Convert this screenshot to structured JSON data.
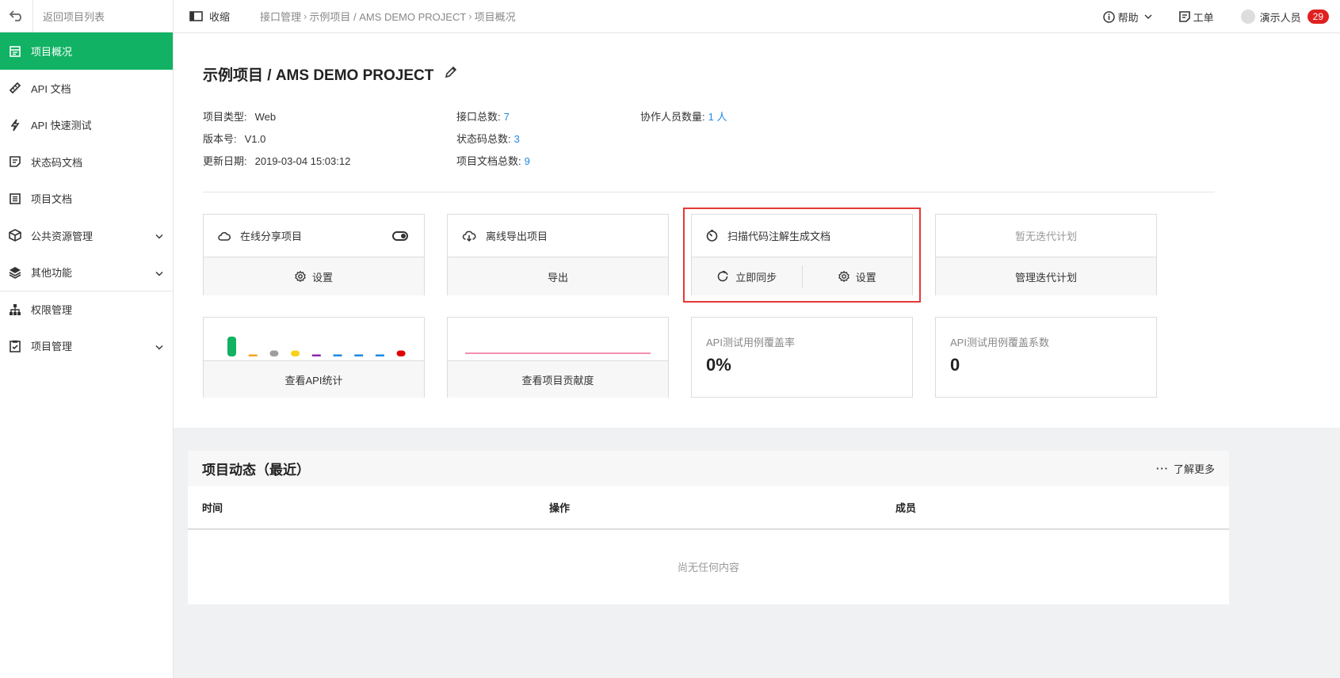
{
  "sidebar": {
    "back_label": "返回项目列表",
    "items": [
      {
        "label": "项目概况",
        "icon": "overview-icon",
        "active": true
      },
      {
        "label": "API 文档",
        "icon": "api-doc-icon"
      },
      {
        "label": "API 快速测试",
        "icon": "lightning-icon"
      },
      {
        "label": "状态码文档",
        "icon": "status-doc-icon"
      },
      {
        "label": "项目文档",
        "icon": "project-doc-icon"
      },
      {
        "label": "公共资源管理",
        "icon": "cube-icon",
        "expandable": true
      },
      {
        "label": "其他功能",
        "icon": "layers-icon",
        "expandable": true
      },
      {
        "label": "权限管理",
        "icon": "hierarchy-icon"
      },
      {
        "label": "项目管理",
        "icon": "clipboard-check-icon",
        "expandable": true
      }
    ]
  },
  "topbar": {
    "collapse_label": "收缩",
    "breadcrumb": [
      "接口管理",
      "示例项目 / AMS DEMO PROJECT",
      "项目概况"
    ],
    "help_label": "帮助",
    "ticket_label": "工单",
    "user_name": "演示人员",
    "notification_count": "29"
  },
  "project": {
    "title": "示例项目 / AMS DEMO PROJECT",
    "type_label": "项目类型:",
    "type_value": "Web",
    "version_label": "版本号:",
    "version_value": "V1.0",
    "updated_label": "更新日期:",
    "updated_value": "2019-03-04 15:03:12",
    "api_total_label": "接口总数:",
    "api_total_value": "7",
    "status_total_label": "状态码总数:",
    "status_total_value": "3",
    "doc_total_label": "项目文档总数:",
    "doc_total_value": "9",
    "members_label": "协作人员数量:",
    "members_value": "1 人"
  },
  "cards": {
    "share": {
      "title": "在线分享项目",
      "action": "设置",
      "toggle_on": true
    },
    "export": {
      "title": "离线导出项目",
      "action": "导出"
    },
    "scan": {
      "title": "扫描代码注解生成文档",
      "sync": "立即同步",
      "settings": "设置"
    },
    "iteration": {
      "title": "暂无迭代计划",
      "action": "管理迭代计划"
    },
    "api_stats": {
      "action": "查看API统计"
    },
    "contribution": {
      "action": "查看项目贡献度"
    },
    "coverage_rate": {
      "label": "API测试用例覆盖率",
      "value": "0%"
    },
    "coverage_coef": {
      "label": "API测试用例覆盖系数",
      "value": "0"
    }
  },
  "mini_bar_colors": [
    "#11b263",
    "#f5a623",
    "#9e9e9e",
    "#f8d21c",
    "#8e24aa",
    "#1e88e5",
    "#1e88e5",
    "#1e88e5",
    "#e00000"
  ],
  "mini_bar_levels": [
    1,
    0.1,
    0.3,
    0.3,
    0.1,
    0.1,
    0.1,
    0.1,
    0.3
  ],
  "contribution_line_color": "#e91e63",
  "activity": {
    "title": "项目动态（最近）",
    "more_label": "了解更多",
    "columns": [
      "时间",
      "操作",
      "成员"
    ],
    "empty_text": "尚无任何内容"
  }
}
